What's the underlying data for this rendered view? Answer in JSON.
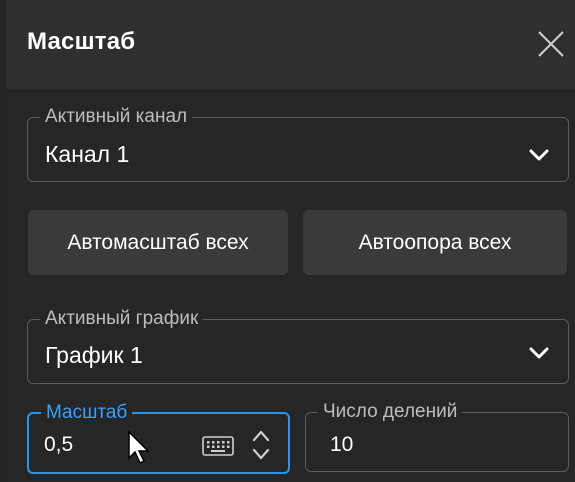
{
  "title": "Масштаб",
  "active_channel": {
    "label": "Активный канал",
    "value": "Канал 1"
  },
  "buttons": {
    "autoscale_all": "Автомасштаб всех",
    "autoref_all": "Автоопора всех"
  },
  "active_trace": {
    "label": "Активный график",
    "value": "График 1"
  },
  "scale": {
    "label": "Масштаб",
    "value": "0,5"
  },
  "divisions": {
    "label": "Число делений",
    "value": "10"
  },
  "colors": {
    "accent": "#2196f3",
    "background": "#262626",
    "header": "#2f2f2f",
    "button": "#3a3a3a"
  }
}
